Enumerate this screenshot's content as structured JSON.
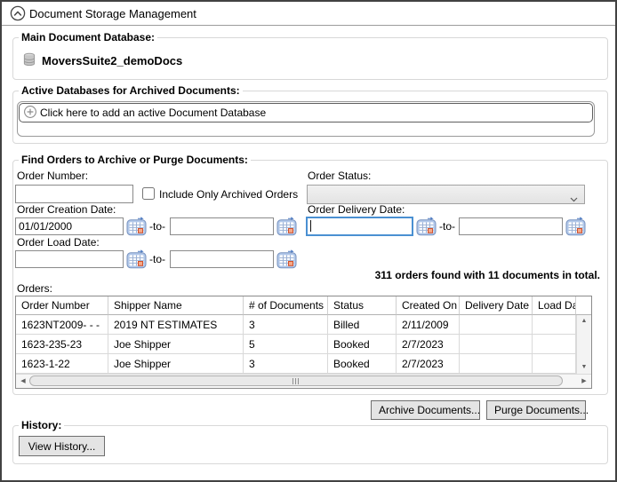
{
  "header": {
    "title": "Document Storage Management"
  },
  "main_db": {
    "label": "Main Document Database:",
    "name": "MoversSuite2_demoDocs"
  },
  "active_dbs": {
    "label": "Active Databases for Archived Documents:",
    "add_button": "Click here to add an active Document Database"
  },
  "find_orders": {
    "label": "Find Orders to Archive or Purge Documents:",
    "order_number_label": "Order Number:",
    "order_number_value": "",
    "include_archived_label": "Include Only Archived Orders",
    "order_status_label": "Order Status:",
    "order_status_value": "",
    "creation_date_label": "Order Creation Date:",
    "creation_from": "01/01/2000",
    "creation_to": "",
    "delivery_date_label": "Order Delivery Date:",
    "delivery_from": "",
    "delivery_to": "",
    "load_date_label": "Order Load Date:",
    "load_from": "",
    "load_to": "",
    "to_separator": "-to-",
    "results_summary": "311 orders found with 11 documents in total.",
    "orders_label": "Orders:",
    "table": {
      "columns": [
        "Order Number",
        "Shipper Name",
        "# of Documents",
        "Status",
        "Created On",
        "Delivery Date",
        "Load Date"
      ],
      "rows": [
        [
          "1623NT2009- - -",
          "2019 NT ESTIMATES",
          "3",
          "Billed",
          "2/11/2009",
          "",
          ""
        ],
        [
          "1623-235-23",
          "Joe Shipper",
          "5",
          "Booked",
          "2/7/2023",
          "",
          ""
        ],
        [
          "1623-1-22",
          "Joe Shipper",
          "3",
          "Booked",
          "2/7/2023",
          "",
          ""
        ]
      ]
    }
  },
  "actions": {
    "archive_label": "Archive Documents...",
    "purge_label": "Purge Documents..."
  },
  "history": {
    "label": "History:",
    "view_button": "View History..."
  },
  "colors": {
    "focus_border": "#4a90d2",
    "panel_border": "#424242"
  }
}
